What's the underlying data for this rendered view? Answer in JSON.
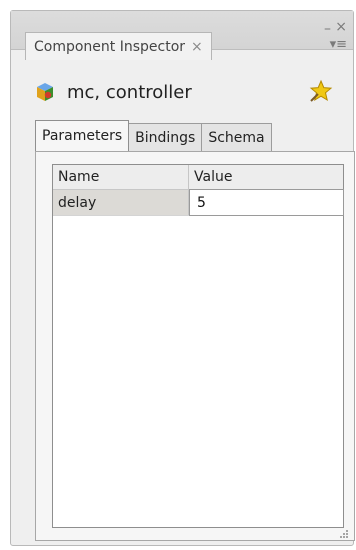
{
  "panel": {
    "tab_label": "Component Inspector",
    "tab_close_glyph": "×",
    "minimize_glyph": "–",
    "close_glyph": "×",
    "menu_glyph": "▾≡"
  },
  "component": {
    "name": "mc, controller",
    "icon": "component-icon",
    "action_icon": "star-icon"
  },
  "tabs": [
    {
      "label": "Parameters",
      "active": true
    },
    {
      "label": "Bindings",
      "active": false
    },
    {
      "label": "Schema",
      "active": false
    }
  ],
  "grid": {
    "columns": [
      "Name",
      "Value"
    ],
    "rows": [
      {
        "name": "delay",
        "value": "5"
      }
    ]
  }
}
